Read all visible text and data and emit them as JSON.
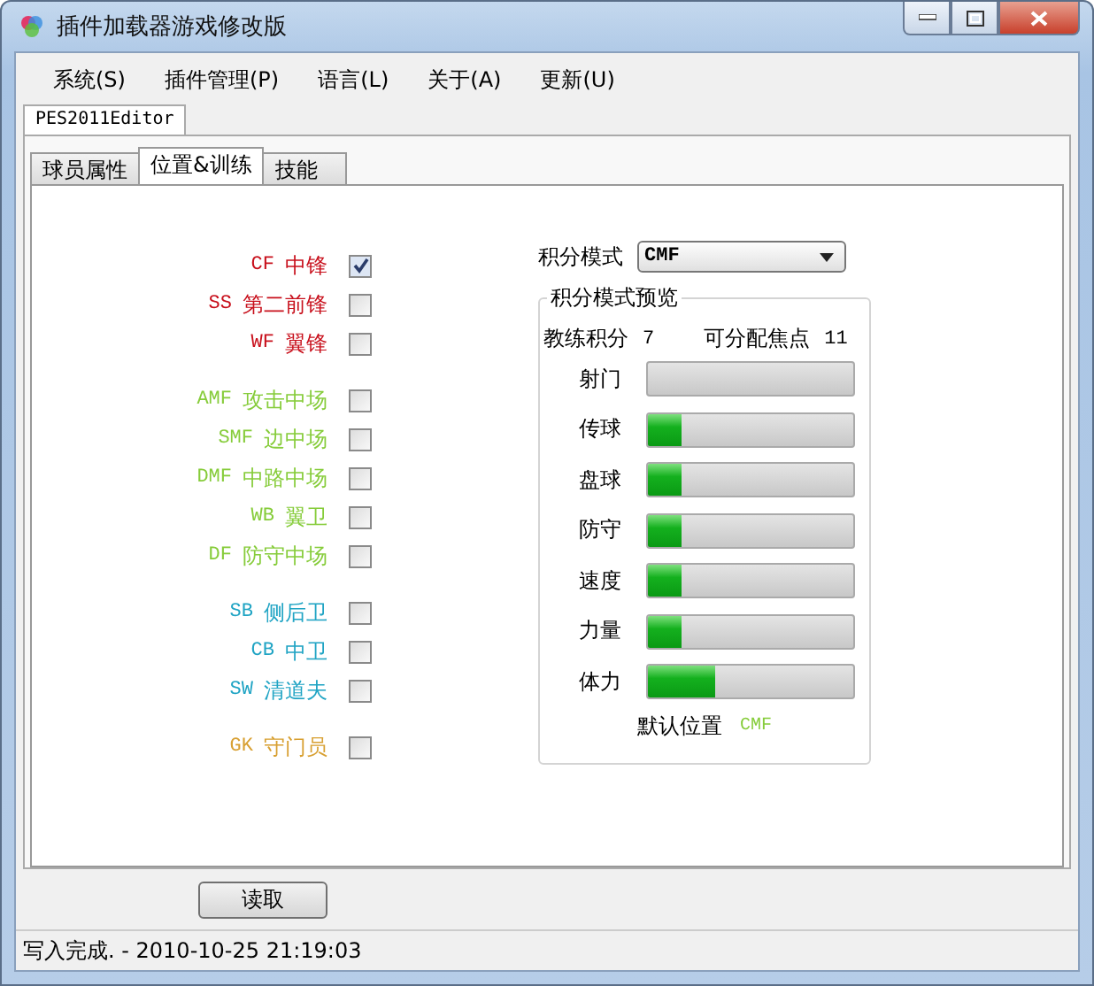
{
  "window": {
    "title": "插件加载器游戏修改版"
  },
  "menu": [
    {
      "label": "系统(S)"
    },
    {
      "label": "插件管理(P)"
    },
    {
      "label": "语言(L)"
    },
    {
      "label": "关于(A)"
    },
    {
      "label": "更新(U)"
    }
  ],
  "outer_tabs": [
    {
      "label": "PES2011Editor",
      "selected": true
    }
  ],
  "tabs": [
    {
      "label": "球员属性",
      "selected": false
    },
    {
      "label": "位置&训练",
      "selected": true
    },
    {
      "label": "技能",
      "selected": false
    }
  ],
  "position_groups": [
    {
      "color": "#c8101c",
      "positions": [
        {
          "code": "CF",
          "name": "中锋",
          "checked": true
        },
        {
          "code": "SS",
          "name": "第二前锋",
          "checked": false
        },
        {
          "code": "WF",
          "name": "翼锋",
          "checked": false
        }
      ]
    },
    {
      "color": "#86cc3a",
      "positions": [
        {
          "code": "AMF",
          "name": "攻击中场",
          "checked": false
        },
        {
          "code": "SMF",
          "name": "边中场",
          "checked": false
        },
        {
          "code": "DMF",
          "name": "中路中场",
          "checked": false
        },
        {
          "code": "WB",
          "name": "翼卫",
          "checked": false
        },
        {
          "code": "DF",
          "name": "防守中场",
          "checked": false
        }
      ]
    },
    {
      "color": "#20a4c4",
      "positions": [
        {
          "code": "SB",
          "name": "侧后卫",
          "checked": false
        },
        {
          "code": "CB",
          "name": "中卫",
          "checked": false
        },
        {
          "code": "SW",
          "name": "清道夫",
          "checked": false
        }
      ]
    },
    {
      "color": "#d8a032",
      "positions": [
        {
          "code": "GK",
          "name": "守门员",
          "checked": false
        }
      ]
    }
  ],
  "mode": {
    "label": "积分模式",
    "value": "CMF"
  },
  "preview": {
    "title": "积分模式预览",
    "coach_label": "教练积分",
    "coach_value": "7",
    "focus_label": "可分配焦点",
    "focus_value": "11",
    "stats": [
      {
        "name": "射门",
        "level": 0
      },
      {
        "name": "传球",
        "level": 0.16
      },
      {
        "name": "盘球",
        "level": 0.16
      },
      {
        "name": "防守",
        "level": 0.16
      },
      {
        "name": "速度",
        "level": 0.16
      },
      {
        "name": "力量",
        "level": 0.16
      },
      {
        "name": "体力",
        "level": 0.33
      }
    ],
    "default_label": "默认位置",
    "default_value": "CMF"
  },
  "read_button": "读取",
  "status_bar": "写入完成. - 2010-10-25 21:19:03"
}
